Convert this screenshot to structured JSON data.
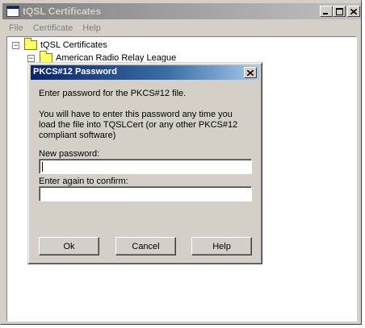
{
  "window": {
    "title": "tQSL Certificates",
    "controls": {
      "minimize": "_",
      "maximize": "□",
      "close": "×"
    }
  },
  "menu": [
    {
      "label": "File"
    },
    {
      "label": "Certificate"
    },
    {
      "label": "Help"
    }
  ],
  "tree": {
    "root": {
      "label": "tQSL Certificates",
      "expander": "−"
    },
    "child": {
      "label": "American Radio Relay League",
      "expander": "−"
    }
  },
  "dialog": {
    "title": "PKCS#12 Password",
    "close": "×",
    "intro": "Enter password for the PKCS#12 file.",
    "note_line1": "You will have to enter this password any time you",
    "note_line2": "load the file into TQSLCert (or any other PKCS#12",
    "note_line3": "compliant software)",
    "new_password_label": "New password:",
    "new_password_value": "",
    "confirm_label": "Enter again to confirm:",
    "confirm_value": "",
    "buttons": {
      "ok": "Ok",
      "cancel": "Cancel",
      "help": "Help"
    }
  },
  "colors": {
    "dialog_title_active": "#0a246a",
    "window_title_inactive": "#808080",
    "face": "#d4d0c8"
  }
}
